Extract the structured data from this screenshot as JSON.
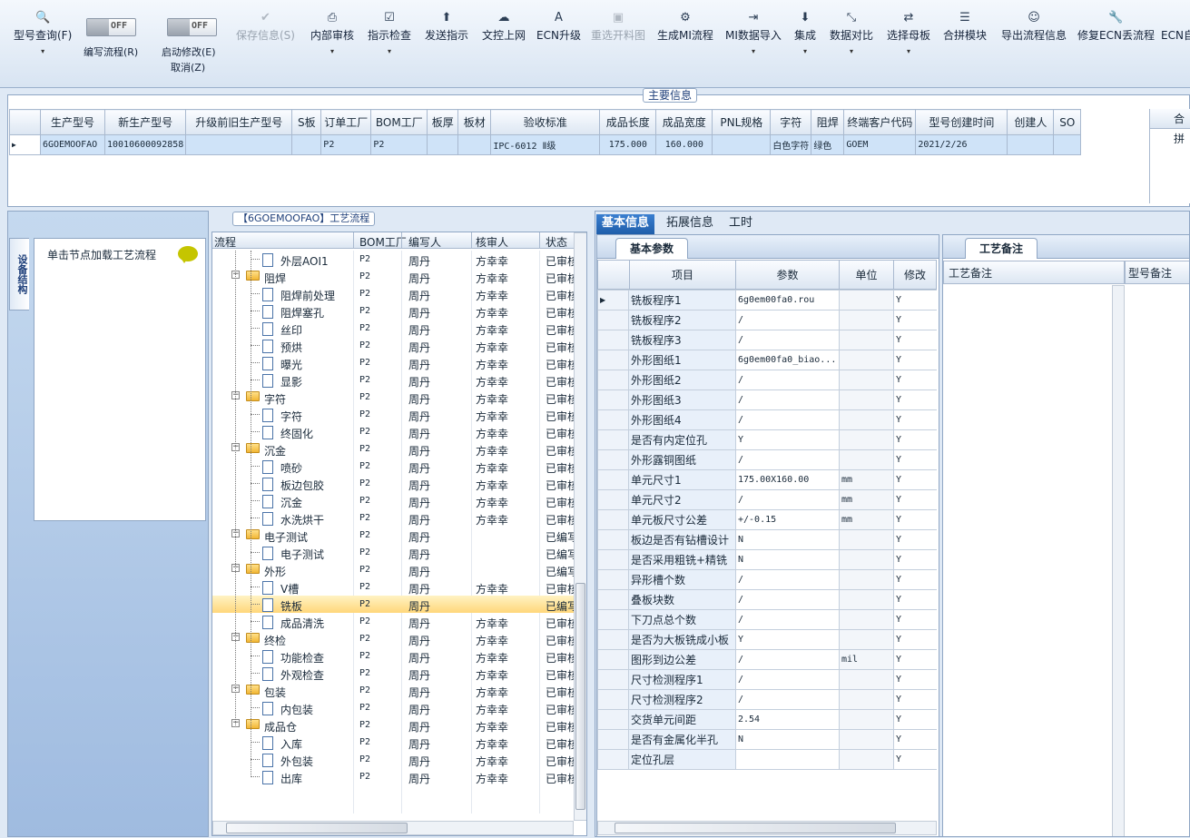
{
  "toolbar": {
    "buttons": [
      {
        "label": "型号查询(F)",
        "icon": "search-icon"
      },
      {
        "label": "保存信息(S)",
        "icon": "check-icon"
      },
      {
        "label": "内部审核",
        "icon": "print-icon"
      },
      {
        "label": "指示检查",
        "icon": "checkbox-icon"
      },
      {
        "label": "发送指示",
        "icon": "upload-icon"
      },
      {
        "label": "文控上网",
        "icon": "cloud-upload-icon"
      },
      {
        "label": "ECN升级",
        "icon": "font-icon"
      },
      {
        "label": "重选开料图",
        "icon": "image-icon"
      },
      {
        "label": "生成MI流程",
        "icon": "gears-icon"
      },
      {
        "label": "MI数据导入",
        "icon": "import-icon"
      },
      {
        "label": "集成",
        "icon": "download-icon"
      },
      {
        "label": "数据对比",
        "icon": "compress-icon"
      },
      {
        "label": "选择母板",
        "icon": "shuffle-icon"
      },
      {
        "label": "合拼模块",
        "icon": "list-icon"
      },
      {
        "label": "导出流程信息",
        "icon": "smile-icon"
      },
      {
        "label": "修复ECN丢流程",
        "icon": "wrench-icon"
      },
      {
        "label": "ECN自",
        "icon": "none"
      }
    ],
    "toggle_off": "OFF",
    "write_flow": "编写流程(R)",
    "start_modify": "启动修改(E)",
    "cancel": "取消(Z)"
  },
  "main_info": {
    "title": "主要信息",
    "headers": [
      "生产型号",
      "新生产型号",
      "升级前旧生产型号",
      "S板",
      "订单工厂",
      "BOM工厂",
      "板厚",
      "板材",
      "验收标准",
      "成品长度",
      "成品宽度",
      "PNL规格",
      "字符",
      "阻焊",
      "终端客户代码",
      "型号创建时间",
      "创建人",
      "SO"
    ],
    "row": [
      "6GOEMOOFAO",
      "10010600092858",
      "",
      "",
      "P2",
      "P2",
      "",
      "",
      "IPC-6012 Ⅱ级",
      "175.000",
      "160.000",
      "",
      "白色字符",
      "绿色",
      "GOEM",
      "2021/2/26",
      "",
      ""
    ],
    "right_header": "合拼"
  },
  "left_panel": {
    "side_tab": "设备结构",
    "hint": "单击节点加载工艺流程"
  },
  "flow": {
    "title": "【6GOEMOOFAO】工艺流程",
    "headers": [
      "流程",
      "BOM工厂",
      "编写人",
      "核审人",
      "状态"
    ],
    "rows": [
      {
        "name": "外层AOI1",
        "level": 1,
        "f": "P2",
        "w": "周丹",
        "r": "方幸幸",
        "s": "已审核"
      },
      {
        "name": "阻焊",
        "level": 0,
        "f": "P2",
        "w": "周丹",
        "r": "方幸幸",
        "s": "已审核"
      },
      {
        "name": "阻焊前处理",
        "level": 1,
        "f": "P2",
        "w": "周丹",
        "r": "方幸幸",
        "s": "已审核"
      },
      {
        "name": "阻焊塞孔",
        "level": 1,
        "f": "P2",
        "w": "周丹",
        "r": "方幸幸",
        "s": "已审核"
      },
      {
        "name": "丝印",
        "level": 1,
        "f": "P2",
        "w": "周丹",
        "r": "方幸幸",
        "s": "已审核"
      },
      {
        "name": "预烘",
        "level": 1,
        "f": "P2",
        "w": "周丹",
        "r": "方幸幸",
        "s": "已审核"
      },
      {
        "name": "曝光",
        "level": 1,
        "f": "P2",
        "w": "周丹",
        "r": "方幸幸",
        "s": "已审核"
      },
      {
        "name": "显影",
        "level": 1,
        "f": "P2",
        "w": "周丹",
        "r": "方幸幸",
        "s": "已审核"
      },
      {
        "name": "字符",
        "level": 0,
        "f": "P2",
        "w": "周丹",
        "r": "方幸幸",
        "s": "已审核"
      },
      {
        "name": "字符",
        "level": 1,
        "f": "P2",
        "w": "周丹",
        "r": "方幸幸",
        "s": "已审核"
      },
      {
        "name": "终固化",
        "level": 1,
        "f": "P2",
        "w": "周丹",
        "r": "方幸幸",
        "s": "已审核"
      },
      {
        "name": "沉金",
        "level": 0,
        "f": "P2",
        "w": "周丹",
        "r": "方幸幸",
        "s": "已审核"
      },
      {
        "name": "喷砂",
        "level": 1,
        "f": "P2",
        "w": "周丹",
        "r": "方幸幸",
        "s": "已审核"
      },
      {
        "name": "板边包胶",
        "level": 1,
        "f": "P2",
        "w": "周丹",
        "r": "方幸幸",
        "s": "已审核"
      },
      {
        "name": "沉金",
        "level": 1,
        "f": "P2",
        "w": "周丹",
        "r": "方幸幸",
        "s": "已审核"
      },
      {
        "name": "水洗烘干",
        "level": 1,
        "f": "P2",
        "w": "周丹",
        "r": "方幸幸",
        "s": "已审核"
      },
      {
        "name": "电子测试",
        "level": 0,
        "f": "P2",
        "w": "周丹",
        "r": "",
        "s": "已编写"
      },
      {
        "name": "电子测试",
        "level": 1,
        "f": "P2",
        "w": "周丹",
        "r": "",
        "s": "已编写"
      },
      {
        "name": "外形",
        "level": 0,
        "f": "P2",
        "w": "周丹",
        "r": "",
        "s": "已编写"
      },
      {
        "name": "V槽",
        "level": 1,
        "f": "P2",
        "w": "周丹",
        "r": "方幸幸",
        "s": "已审核"
      },
      {
        "name": "铣板",
        "level": 1,
        "f": "P2",
        "w": "周丹",
        "r": "",
        "s": "已编写",
        "selected": true
      },
      {
        "name": "成品清洗",
        "level": 1,
        "f": "P2",
        "w": "周丹",
        "r": "方幸幸",
        "s": "已审核"
      },
      {
        "name": "终检",
        "level": 0,
        "f": "P2",
        "w": "周丹",
        "r": "方幸幸",
        "s": "已审核"
      },
      {
        "name": "功能检查",
        "level": 1,
        "f": "P2",
        "w": "周丹",
        "r": "方幸幸",
        "s": "已审核"
      },
      {
        "name": "外观检查",
        "level": 1,
        "f": "P2",
        "w": "周丹",
        "r": "方幸幸",
        "s": "已审核"
      },
      {
        "name": "包装",
        "level": 0,
        "f": "P2",
        "w": "周丹",
        "r": "方幸幸",
        "s": "已审核"
      },
      {
        "name": "内包装",
        "level": 1,
        "f": "P2",
        "w": "周丹",
        "r": "方幸幸",
        "s": "已审核"
      },
      {
        "name": "成品仓",
        "level": 0,
        "f": "P2",
        "w": "周丹",
        "r": "方幸幸",
        "s": "已审核"
      },
      {
        "name": "入库",
        "level": 1,
        "f": "P2",
        "w": "周丹",
        "r": "方幸幸",
        "s": "已审核"
      },
      {
        "name": "外包装",
        "level": 1,
        "f": "P2",
        "w": "周丹",
        "r": "方幸幸",
        "s": "已审核"
      },
      {
        "name": "出库",
        "level": 1,
        "f": "P2",
        "w": "周丹",
        "r": "方幸幸",
        "s": "已审核"
      }
    ]
  },
  "detail": {
    "tabs": [
      "基本信息",
      "拓展信息",
      "工时"
    ],
    "section": "基本参数",
    "headers": [
      "项目",
      "参数",
      "单位",
      "修改"
    ],
    "rows": [
      {
        "k": "铣板程序1",
        "v": "6g0em00fa0.rou",
        "u": "",
        "m": "Y"
      },
      {
        "k": "铣板程序2",
        "v": "/",
        "u": "",
        "m": "Y"
      },
      {
        "k": "铣板程序3",
        "v": "/",
        "u": "",
        "m": "Y"
      },
      {
        "k": "外形图纸1",
        "v": "6g0em00fa0_biao...",
        "u": "",
        "m": "Y"
      },
      {
        "k": "外形图纸2",
        "v": "/",
        "u": "",
        "m": "Y"
      },
      {
        "k": "外形图纸3",
        "v": "/",
        "u": "",
        "m": "Y"
      },
      {
        "k": "外形图纸4",
        "v": "/",
        "u": "",
        "m": "Y"
      },
      {
        "k": "是否有内定位孔",
        "v": "Y",
        "u": "",
        "m": "Y"
      },
      {
        "k": "外形露铜图纸",
        "v": "/",
        "u": "",
        "m": "Y"
      },
      {
        "k": "单元尺寸1",
        "v": "175.00X160.00",
        "u": "mm",
        "m": "Y"
      },
      {
        "k": "单元尺寸2",
        "v": "/",
        "u": "mm",
        "m": "Y"
      },
      {
        "k": "单元板尺寸公差",
        "v": "+/-0.15",
        "u": "mm",
        "m": "Y"
      },
      {
        "k": "板边是否有钻槽设计",
        "v": "N",
        "u": "",
        "m": "Y"
      },
      {
        "k": "是否采用粗铣+精铣",
        "v": "N",
        "u": "",
        "m": "Y"
      },
      {
        "k": "异形槽个数",
        "v": "/",
        "u": "",
        "m": "Y"
      },
      {
        "k": "叠板块数",
        "v": "/",
        "u": "",
        "m": "Y"
      },
      {
        "k": "下刀点总个数",
        "v": "/",
        "u": "",
        "m": "Y"
      },
      {
        "k": "是否为大板铣成小板",
        "v": "Y",
        "u": "",
        "m": "Y"
      },
      {
        "k": "图形到边公差",
        "v": "/",
        "u": "mil",
        "m": "Y"
      },
      {
        "k": "尺寸检测程序1",
        "v": "/",
        "u": "",
        "m": "Y"
      },
      {
        "k": "尺寸检测程序2",
        "v": "/",
        "u": "",
        "m": "Y"
      },
      {
        "k": "交货单元间距",
        "v": "2.54",
        "u": "",
        "m": "Y"
      },
      {
        "k": "是否有金属化半孔",
        "v": "N",
        "u": "",
        "m": "Y"
      },
      {
        "k": "定位孔层",
        "v": "",
        "u": "",
        "m": "Y"
      }
    ]
  },
  "remarks": {
    "tab": "工艺备注",
    "col1": "工艺备注",
    "col2": "型号备注"
  }
}
